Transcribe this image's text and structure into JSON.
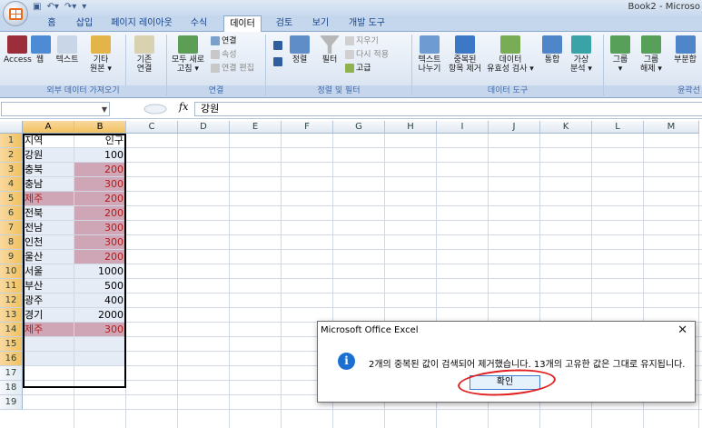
{
  "title": "Book2 - Microso",
  "qat": {
    "save": "▣",
    "undo": "↶▾",
    "redo": "↷▾",
    "more": "▾"
  },
  "tabs": [
    "홈",
    "삽입",
    "페이지 레이아웃",
    "수식",
    "데이터",
    "검토",
    "보기",
    "개발 도구"
  ],
  "active_tab": "데이터",
  "ribbon": {
    "group_external": "외부 데이터 가져오기",
    "group_connections": "연결",
    "group_sort": "정렬 및 필터",
    "group_tools": "데이터 도구",
    "group_outline": "윤곽선",
    "access": "Access",
    "web": "웹",
    "text": "텍스트",
    "other_1": "기타",
    "other_2": "원본 ▾",
    "existing_1": "기존",
    "existing_2": "연결",
    "refresh_1": "모두 새로",
    "refresh_2": "고침 ▾",
    "connections": "연결",
    "properties": "속성",
    "edit_links": "연결 편집",
    "sort": "정렬",
    "filter": "필터",
    "clear": "지우기",
    "reapply": "다시 적용",
    "advanced": "고급",
    "text_columns_1": "텍스트",
    "text_columns_2": "나누기",
    "remove_dup_1": "중복된",
    "remove_dup_2": "항목 제거",
    "validation_1": "데이터",
    "validation_2": "유효성 검사 ▾",
    "consolidate": "통합",
    "whatif_1": "가상",
    "whatif_2": "분석 ▾",
    "group_btn_1": "그룹",
    "group_btn_2": "▾",
    "ungroup_1": "그룹",
    "ungroup_2": "해제 ▾",
    "subtotal": "부분합"
  },
  "formula": {
    "name_box": "",
    "fx": "fx",
    "content": "강원"
  },
  "columns": [
    "A",
    "B",
    "C",
    "D",
    "E",
    "F",
    "G",
    "H",
    "I",
    "J",
    "K",
    "L",
    "M"
  ],
  "rows": [
    "1",
    "2",
    "3",
    "4",
    "5",
    "6",
    "7",
    "8",
    "9",
    "10",
    "11",
    "12",
    "13",
    "14",
    "15",
    "16",
    "17",
    "18",
    "19"
  ],
  "cells": [
    {
      "a": "지역",
      "b": "인구",
      "fill_a": false,
      "fill_b": false,
      "red": false
    },
    {
      "a": "강원",
      "b": "100",
      "fill_a": false,
      "fill_b": false,
      "red": false
    },
    {
      "a": "충북",
      "b": "200",
      "fill_a": false,
      "fill_b": true,
      "red": true
    },
    {
      "a": "충남",
      "b": "300",
      "fill_a": false,
      "fill_b": true,
      "red": true
    },
    {
      "a": "제주",
      "b": "200",
      "fill_a": true,
      "fill_b": true,
      "red": true
    },
    {
      "a": "전북",
      "b": "200",
      "fill_a": false,
      "fill_b": true,
      "red": true
    },
    {
      "a": "전남",
      "b": "300",
      "fill_a": false,
      "fill_b": true,
      "red": true
    },
    {
      "a": "인천",
      "b": "300",
      "fill_a": false,
      "fill_b": true,
      "red": true
    },
    {
      "a": "울산",
      "b": "200",
      "fill_a": false,
      "fill_b": true,
      "red": true
    },
    {
      "a": "서울",
      "b": "1000",
      "fill_a": false,
      "fill_b": false,
      "red": false
    },
    {
      "a": "부산",
      "b": "500",
      "fill_a": false,
      "fill_b": false,
      "red": false
    },
    {
      "a": "광주",
      "b": "400",
      "fill_a": false,
      "fill_b": false,
      "red": false
    },
    {
      "a": "경기",
      "b": "2000",
      "fill_a": false,
      "fill_b": false,
      "red": false
    },
    {
      "a": "제주",
      "b": "300",
      "fill_a": true,
      "fill_b": true,
      "red": true
    },
    {
      "a": "",
      "b": "",
      "fill_a": false,
      "fill_b": false,
      "red": false
    },
    {
      "a": "",
      "b": "",
      "fill_a": false,
      "fill_b": false,
      "red": false
    }
  ],
  "colors": {
    "dup_fill": "#cfa6b5",
    "dup_text": "#b31b1b",
    "sel_tint": "#e6ecf5",
    "accent": "#1b6fd1",
    "ring": "#e02020"
  },
  "dialog": {
    "title": "Microsoft Office Excel",
    "close": "✕",
    "icon": "i",
    "message": "2개의 중복된 값이 검색되어 제거했습니다. 13개의 고유한 값은 그대로 유지됩니다.",
    "ok": "확인"
  }
}
